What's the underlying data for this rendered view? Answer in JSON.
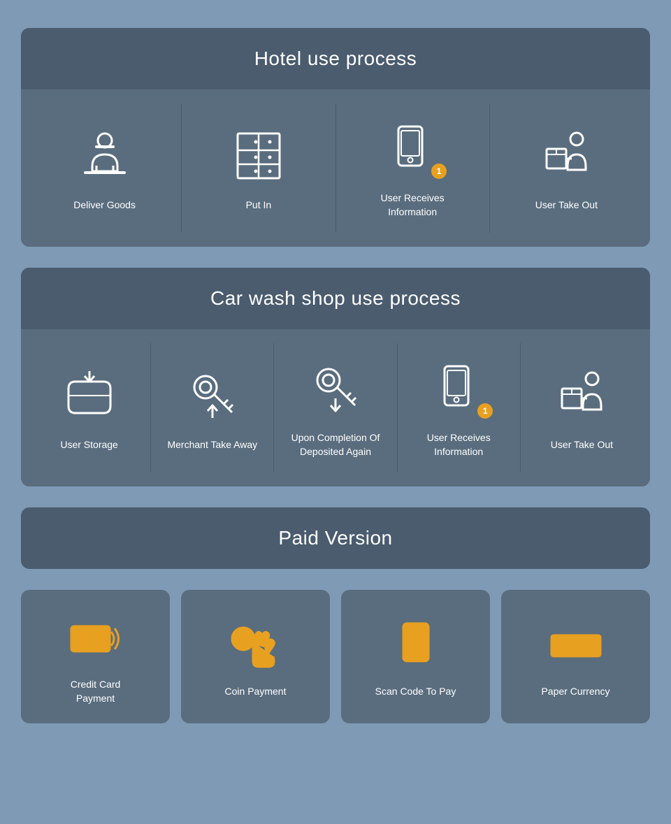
{
  "hotel": {
    "title": "Hotel use process",
    "items": [
      {
        "id": "deliver-goods",
        "label": "Deliver Goods",
        "icon": "delivery-man"
      },
      {
        "id": "put-in",
        "label": "Put In",
        "icon": "locker"
      },
      {
        "id": "user-receives",
        "label": "User Receives\nInformation",
        "icon": "phone-notification"
      },
      {
        "id": "user-take-out",
        "label": "User Take Out",
        "icon": "person-box"
      }
    ]
  },
  "carwash": {
    "title": "Car wash shop use process",
    "items": [
      {
        "id": "user-storage",
        "label": "User Storage",
        "icon": "basket-down"
      },
      {
        "id": "merchant-take-away",
        "label": "Merchant Take Away",
        "icon": "key-up"
      },
      {
        "id": "upon-completion",
        "label": "Upon Completion Of\nDeposited Again",
        "icon": "key-down"
      },
      {
        "id": "user-receives-cw",
        "label": "User Receives\nInformation",
        "icon": "phone-notification"
      },
      {
        "id": "user-take-out-cw",
        "label": "User Take Out",
        "icon": "person-box"
      }
    ]
  },
  "paid": {
    "title": "Paid Version",
    "items": [
      {
        "id": "credit-card",
        "label": "Credit Card\nPayment",
        "icon": "credit-card"
      },
      {
        "id": "coin-payment",
        "label": "Coin Payment",
        "icon": "coin-tap"
      },
      {
        "id": "scan-code",
        "label": "Scan Code To Pay",
        "icon": "scan-phone"
      },
      {
        "id": "paper-currency",
        "label": "Paper Currency",
        "icon": "paper-currency"
      }
    ]
  }
}
